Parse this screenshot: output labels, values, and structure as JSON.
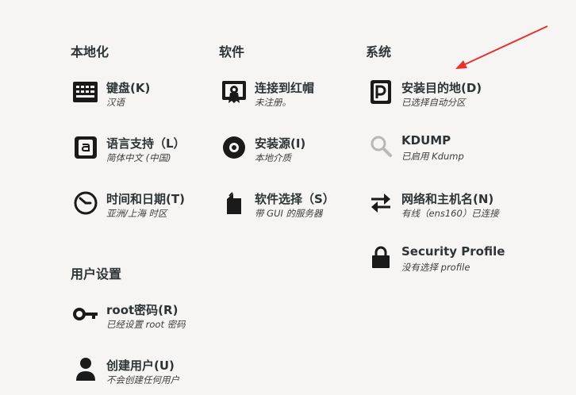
{
  "sections": {
    "localization": "本地化",
    "software": "软件",
    "system": "系统",
    "user_settings": "用户设置"
  },
  "spokes": {
    "keyboard": {
      "title": "键盘(K)",
      "status": "汉语",
      "icon": "keyboard-icon"
    },
    "language": {
      "title": "语言支持（L）",
      "status": "简体中文 (中国)",
      "icon": "language-icon"
    },
    "time": {
      "title": "时间和日期(T)",
      "status": "亚洲/上海 时区",
      "icon": "clock-icon"
    },
    "redhat": {
      "title": "连接到红帽",
      "status": "未注册。",
      "icon": "redhat-subscription-icon"
    },
    "source": {
      "title": "安装源(I)",
      "status": "本地介质",
      "icon": "disc-icon"
    },
    "software": {
      "title": "软件选择（S）",
      "status": "带 GUI 的服务器",
      "icon": "package-icon"
    },
    "destination": {
      "title": "安装目的地(D)",
      "status": "已选择自动分区",
      "icon": "harddisk-icon"
    },
    "kdump": {
      "title": "KDUMP",
      "status": "已启用 Kdump",
      "icon": "search-icon"
    },
    "network": {
      "title": "网络和主机名(N)",
      "status": "有线（ens160）已连接",
      "icon": "network-arrows-icon"
    },
    "security": {
      "title": "Security Profile",
      "status": "没有选择 profile",
      "icon": "lock-icon"
    },
    "root": {
      "title": "root密码(R)",
      "status": "已经设置 root 密码",
      "icon": "key-icon"
    },
    "user": {
      "title": "创建用户(U)",
      "status": "不会创建任何用户",
      "icon": "user-icon"
    }
  },
  "annotation": {
    "color": "#e8322b"
  }
}
